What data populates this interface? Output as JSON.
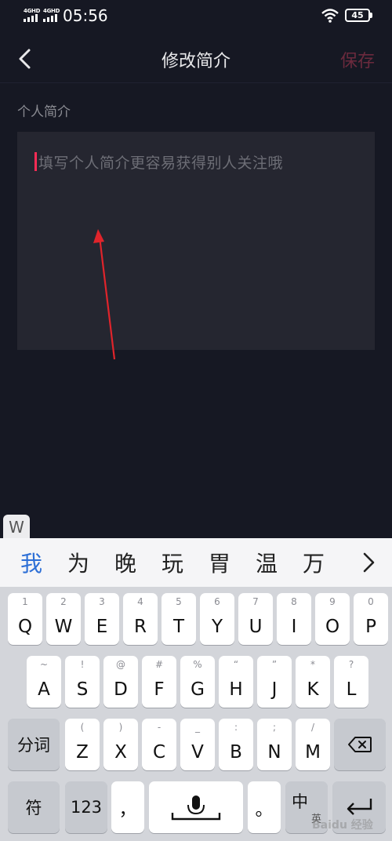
{
  "status_bar": {
    "network1": "4GHD",
    "network2": "4GHD",
    "time": "05:56",
    "battery": "45"
  },
  "header": {
    "title": "修改简介",
    "save_label": "保存"
  },
  "bio": {
    "section_label": "个人简介",
    "placeholder": "填写个人简介更容易获得别人关注哦"
  },
  "keyboard": {
    "tab_label": "W",
    "candidates": [
      "我",
      "为",
      "晚",
      "玩",
      "胃",
      "温",
      "万"
    ],
    "row1": [
      {
        "main": "Q",
        "sub": "1"
      },
      {
        "main": "W",
        "sub": "2"
      },
      {
        "main": "E",
        "sub": "3"
      },
      {
        "main": "R",
        "sub": "4"
      },
      {
        "main": "T",
        "sub": "5"
      },
      {
        "main": "Y",
        "sub": "6"
      },
      {
        "main": "U",
        "sub": "7"
      },
      {
        "main": "I",
        "sub": "8"
      },
      {
        "main": "O",
        "sub": "9"
      },
      {
        "main": "P",
        "sub": "0"
      }
    ],
    "row2": [
      {
        "main": "A",
        "sub": "~"
      },
      {
        "main": "S",
        "sub": "!"
      },
      {
        "main": "D",
        "sub": "@"
      },
      {
        "main": "F",
        "sub": "#"
      },
      {
        "main": "G",
        "sub": "%"
      },
      {
        "main": "H",
        "sub": "“"
      },
      {
        "main": "J",
        "sub": "”"
      },
      {
        "main": "K",
        "sub": "*"
      },
      {
        "main": "L",
        "sub": "?"
      }
    ],
    "row3": [
      {
        "main": "Z",
        "sub": "("
      },
      {
        "main": "X",
        "sub": ")"
      },
      {
        "main": "C",
        "sub": "-"
      },
      {
        "main": "V",
        "sub": "_"
      },
      {
        "main": "B",
        "sub": ":"
      },
      {
        "main": "N",
        "sub": ";"
      },
      {
        "main": "M",
        "sub": "/"
      }
    ],
    "segment_label": "分词",
    "symbol_label": "符",
    "number_label": "123",
    "comma_label": "，",
    "period_label": "。",
    "lang_label": "中",
    "lang_sub": "英"
  },
  "watermark": "Baidu 经验",
  "colors": {
    "background": "#161823",
    "input_bg": "#252630",
    "save_inactive": "#6b2a3d",
    "caret": "#fe2c55",
    "annotation_arrow": "#e0242b",
    "candidate_active": "#2d6fd6"
  }
}
